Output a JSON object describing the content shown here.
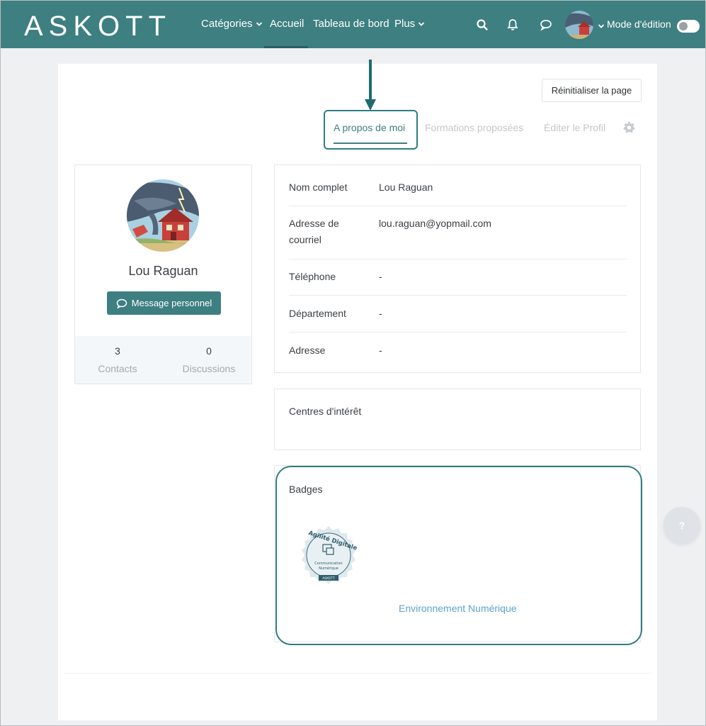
{
  "navbar": {
    "logo": "ASKOTT",
    "items": [
      {
        "label": "Catégories"
      },
      {
        "label": "Accueil"
      },
      {
        "label": "Tableau de bord"
      },
      {
        "label": "Plus"
      }
    ],
    "edit_mode_label": "Mode d'édition",
    "colors": {
      "primary": "#3e7f81",
      "highlight": "#2f7d7f",
      "link": "#5ba3d0"
    }
  },
  "page": {
    "reset_button": "Réinitialiser la page",
    "tabs": [
      {
        "label": "A propos de moi",
        "active": true
      },
      {
        "label": "Formations proposées",
        "active": false
      },
      {
        "label": "Éditer le Profil",
        "active": false
      }
    ]
  },
  "profile": {
    "name": "Lou Raguan",
    "message_button": "Message personnel",
    "stats": [
      {
        "value": "3",
        "label": "Contacts"
      },
      {
        "value": "0",
        "label": "Discussions"
      }
    ]
  },
  "info": {
    "rows": [
      {
        "label": "Nom complet",
        "value": "Lou Raguan"
      },
      {
        "label": "Adresse de courriel",
        "value": "lou.raguan@yopmail.com"
      },
      {
        "label": "Téléphone",
        "value": "-"
      },
      {
        "label": "Département",
        "value": "-"
      },
      {
        "label": "Adresse",
        "value": "-"
      }
    ]
  },
  "interests": {
    "title": "Centres d'intérêt"
  },
  "badges": {
    "title": "Badges",
    "badge_image_text": [
      "Agilité Digitale",
      "Communication",
      "Numérique",
      "ASKOTT"
    ],
    "badge_name": "Environnement Numérique"
  },
  "help": {
    "label": "?"
  }
}
